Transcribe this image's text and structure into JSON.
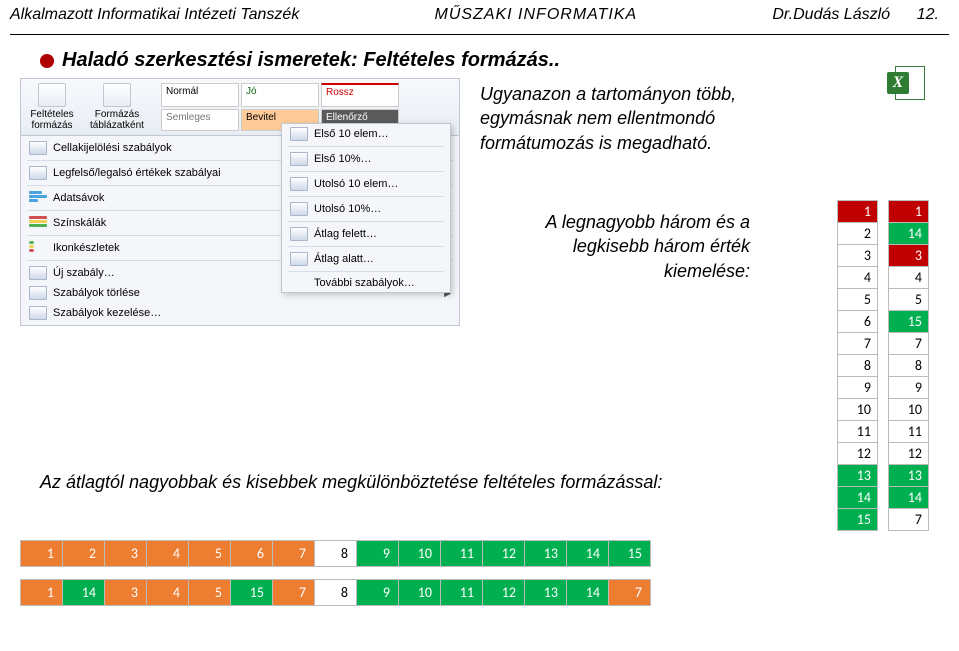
{
  "header": {
    "left": "Alkalmazott Informatikai Intézeti Tanszék",
    "center": "MŰSZAKI INFORMATIKA",
    "right_author": "Dr.Dudás László",
    "right_page": "12."
  },
  "title": "Haladó szerkesztési ismeretek: Feltételes formázás..",
  "intro": "Ugyanazon a tartományon több, egymásnak nem ellentmondó formátumozás is megadható.",
  "mid_text": "A legnagyobb három és a legkisebb három érték kiemelése:",
  "bottom_text": "Az átlagtól nagyobbak és kisebbek megkülönböztetése feltételes formázással:",
  "ribbon": {
    "btn_cond": "Feltételes formázás",
    "btn_table": "Formázás táblázatként",
    "styles": [
      "Normál",
      "Jó",
      "Rossz",
      "Semleges",
      "Bevitel",
      "Ellenőrző"
    ]
  },
  "menu_left": [
    "Cellakijelölési szabályok",
    "Legfelső/legalsó értékek szabályai",
    "Adatsávok",
    "Színskálák",
    "Ikonkészletek",
    "Új szabály…",
    "Szabályok törlése",
    "Szabályok kezelése…"
  ],
  "submenu1": [
    "Első 10 elem…",
    "Első 10%…",
    "Utolsó 10 elem…",
    "Utolsó 10%…",
    "Átlag felett…",
    "Átlag alatt…",
    "További szabályok…"
  ],
  "col_left": [
    {
      "v": 1,
      "c": "red"
    },
    {
      "v": 2,
      "c": ""
    },
    {
      "v": 3,
      "c": ""
    },
    {
      "v": 4,
      "c": ""
    },
    {
      "v": 5,
      "c": ""
    },
    {
      "v": 6,
      "c": ""
    },
    {
      "v": 7,
      "c": ""
    },
    {
      "v": 8,
      "c": ""
    },
    {
      "v": 9,
      "c": ""
    },
    {
      "v": 10,
      "c": ""
    },
    {
      "v": 11,
      "c": ""
    },
    {
      "v": 12,
      "c": ""
    },
    {
      "v": 13,
      "c": "green"
    },
    {
      "v": 14,
      "c": "green"
    },
    {
      "v": 15,
      "c": "green"
    }
  ],
  "col_right": [
    {
      "v": 1,
      "c": "red"
    },
    {
      "v": 14,
      "c": "green"
    },
    {
      "v": 3,
      "c": "red"
    },
    {
      "v": 4,
      "c": ""
    },
    {
      "v": 5,
      "c": ""
    },
    {
      "v": 15,
      "c": "green"
    },
    {
      "v": 7,
      "c": ""
    },
    {
      "v": 8,
      "c": ""
    },
    {
      "v": 9,
      "c": ""
    },
    {
      "v": 10,
      "c": ""
    },
    {
      "v": 11,
      "c": ""
    },
    {
      "v": 12,
      "c": ""
    },
    {
      "v": 13,
      "c": "green"
    },
    {
      "v": 14,
      "c": "green"
    },
    {
      "v": 7,
      "c": ""
    }
  ],
  "row1": [
    {
      "v": 1,
      "c": "orange"
    },
    {
      "v": 2,
      "c": "orange"
    },
    {
      "v": 3,
      "c": "orange"
    },
    {
      "v": 4,
      "c": "orange"
    },
    {
      "v": 5,
      "c": "orange"
    },
    {
      "v": 6,
      "c": "orange"
    },
    {
      "v": 7,
      "c": "orange"
    },
    {
      "v": 8,
      "c": ""
    },
    {
      "v": 9,
      "c": "ogreen"
    },
    {
      "v": 10,
      "c": "ogreen"
    },
    {
      "v": 11,
      "c": "ogreen"
    },
    {
      "v": 12,
      "c": "ogreen"
    },
    {
      "v": 13,
      "c": "ogreen"
    },
    {
      "v": 14,
      "c": "ogreen"
    },
    {
      "v": 15,
      "c": "ogreen"
    }
  ],
  "row2": [
    {
      "v": 1,
      "c": "orange"
    },
    {
      "v": 14,
      "c": "ogreen"
    },
    {
      "v": 3,
      "c": "orange"
    },
    {
      "v": 4,
      "c": "orange"
    },
    {
      "v": 5,
      "c": "orange"
    },
    {
      "v": 15,
      "c": "ogreen"
    },
    {
      "v": 7,
      "c": "orange"
    },
    {
      "v": 8,
      "c": ""
    },
    {
      "v": 9,
      "c": "ogreen"
    },
    {
      "v": 10,
      "c": "ogreen"
    },
    {
      "v": 11,
      "c": "ogreen"
    },
    {
      "v": 12,
      "c": "ogreen"
    },
    {
      "v": 13,
      "c": "ogreen"
    },
    {
      "v": 14,
      "c": "ogreen"
    },
    {
      "v": 7,
      "c": "orange"
    }
  ]
}
